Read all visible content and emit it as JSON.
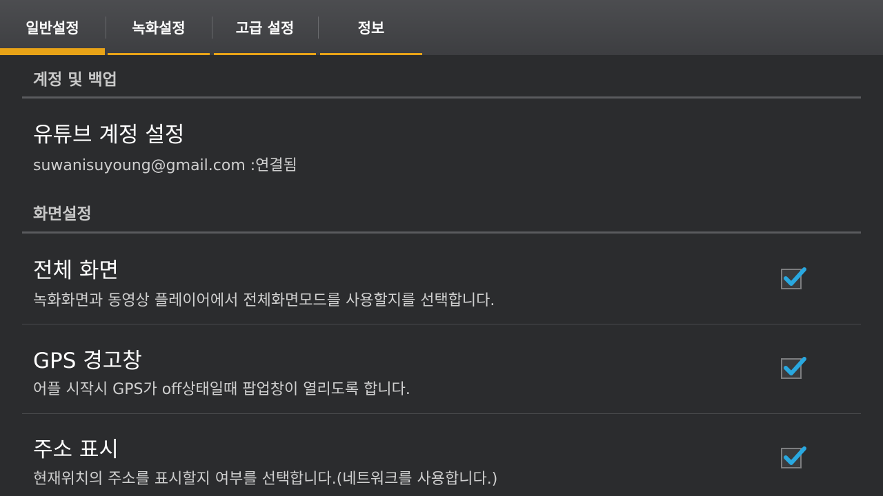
{
  "tabs": [
    {
      "label": "일반설정",
      "active": true
    },
    {
      "label": "녹화설정",
      "active": false
    },
    {
      "label": "고급 설정",
      "active": false
    },
    {
      "label": "정보",
      "active": false
    }
  ],
  "sections": {
    "account": {
      "header": "계정 및 백업",
      "youtube": {
        "title": "유튜브 계정 설정",
        "subtitle": "suwanisuyoung@gmail.com :연결됨"
      }
    },
    "display": {
      "header": "화면설정",
      "items": [
        {
          "title": "전체 화면",
          "subtitle": "녹화화면과 동영상 플레이어에서 전체화면모드를 사용할지를 선택합니다.",
          "checked": true,
          "check_icon": "checkmark-icon"
        },
        {
          "title": "GPS 경고창",
          "subtitle": "어플 시작시 GPS가 off상태일때 팝업창이 열리도록 합니다.",
          "checked": true,
          "check_icon": "checkmark-icon"
        },
        {
          "title": "주소 표시",
          "subtitle": "현재위치의 주소를 표시할지 여부를 선택합니다.(네트워크를 사용합니다.)",
          "checked": true,
          "check_icon": "checkmark-icon"
        }
      ]
    }
  },
  "colors": {
    "accent": "#e8a317",
    "check": "#29a8e0"
  }
}
